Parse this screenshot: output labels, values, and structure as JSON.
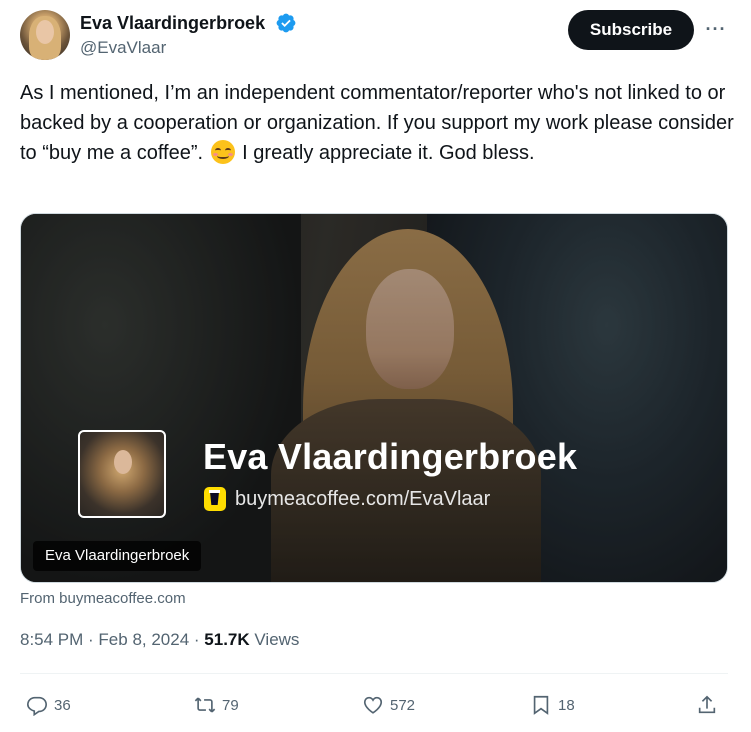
{
  "author": {
    "name": "Eva Vlaardingerbroek",
    "handle": "@EvaVlaar",
    "verified_icon": "verified-badge-icon"
  },
  "header": {
    "subscribe_label": "Subscribe",
    "more_label": "···"
  },
  "tweet": {
    "text_part1": "As I mentioned, I’m an independent commentator/reporter who's not linked to or backed by a cooperation or organization. If you support my work please consider to “buy me a coffee”. ",
    "emoji_name": "smiling-face-with-smiling-eyes-emoji",
    "text_part2": " I greatly appreciate it. God bless."
  },
  "card": {
    "title": "Eva Vlaardingerbroek",
    "url": "buymeacoffee.com/EvaVlaar",
    "label": "Eva Vlaardingerbroek",
    "source": "From buymeacoffee.com"
  },
  "meta": {
    "time": "8:54 PM",
    "separator1": " · ",
    "date": "Feb 8, 2024",
    "separator2": " · ",
    "views_count": "51.7K",
    "views_label": " Views"
  },
  "actions": {
    "replies": "36",
    "reposts": "79",
    "likes": "572",
    "bookmarks": "18"
  },
  "colors": {
    "text": "#0f1419",
    "secondary": "#536471",
    "verified": "#1d9bf0",
    "bmc_yellow": "#ffdd00"
  }
}
